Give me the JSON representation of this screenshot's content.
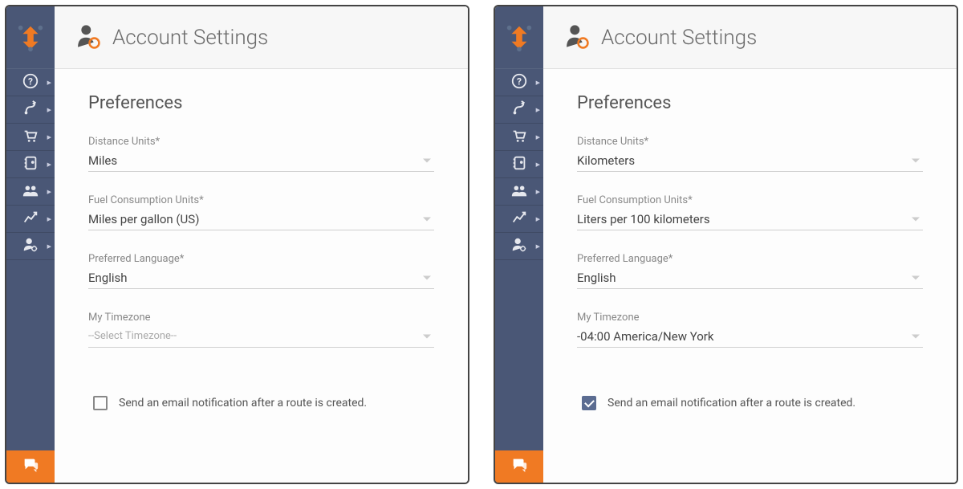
{
  "panels": [
    {
      "title": "Account Settings",
      "section": "Preferences",
      "fields": {
        "distance": {
          "label": "Distance Units*",
          "value": "Miles",
          "placeholder": false
        },
        "fuel": {
          "label": "Fuel Consumption Units*",
          "value": "Miles per gallon (US)",
          "placeholder": false
        },
        "language": {
          "label": "Preferred Language*",
          "value": "English",
          "placeholder": false
        },
        "timezone": {
          "label": "My Timezone",
          "value": "--Select Timezone--",
          "placeholder": true
        }
      },
      "email_notify": {
        "label": "Send an email notification after a route is created.",
        "checked": false
      }
    },
    {
      "title": "Account Settings",
      "section": "Preferences",
      "fields": {
        "distance": {
          "label": "Distance Units*",
          "value": "Kilometers",
          "placeholder": false
        },
        "fuel": {
          "label": "Fuel Consumption Units*",
          "value": "Liters per 100 kilometers",
          "placeholder": false
        },
        "language": {
          "label": "Preferred Language*",
          "value": "English",
          "placeholder": false
        },
        "timezone": {
          "label": "My Timezone",
          "value": "-04:00 America/New York",
          "placeholder": false
        }
      },
      "email_notify": {
        "label": "Send an email notification after a route is created.",
        "checked": true
      }
    }
  ],
  "sidebar_icons": [
    "help",
    "routes",
    "orders",
    "address-book",
    "team",
    "analytics",
    "account"
  ]
}
